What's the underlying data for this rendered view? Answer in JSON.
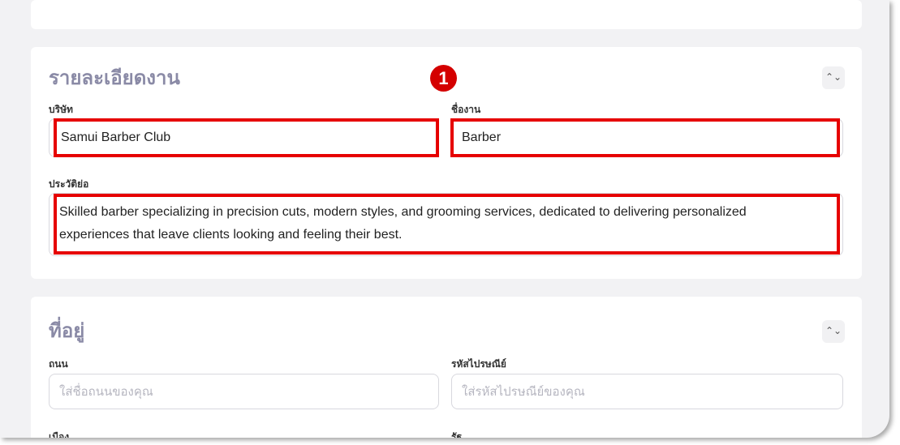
{
  "job_details": {
    "title": "รายละเอียดงาน",
    "toggle_icon": "⌃⌄",
    "company_label": "บริษัท",
    "company_value": "Samui Barber Club",
    "job_title_label": "ชื่องาน",
    "job_title_value": "Barber",
    "bio_label": "ประวัติย่อ",
    "bio_value": "Skilled barber specializing in precision cuts, modern styles, and grooming services, dedicated to delivering personalized experiences that leave clients looking and feeling their best."
  },
  "address": {
    "title": "ที่อยู่",
    "toggle_icon": "⌃⌄",
    "street_label": "ถนน",
    "street_placeholder": "ใส่ชื่อถนนของคุณ",
    "postal_label": "รหัสไปรษณีย์",
    "postal_placeholder": "ใส่รหัสไปรษณีย์ของคุณ",
    "city_label": "เมือง",
    "state_label": "รัฐ"
  },
  "annotation": {
    "step_number": "1",
    "highlight_color": "#e60000"
  }
}
